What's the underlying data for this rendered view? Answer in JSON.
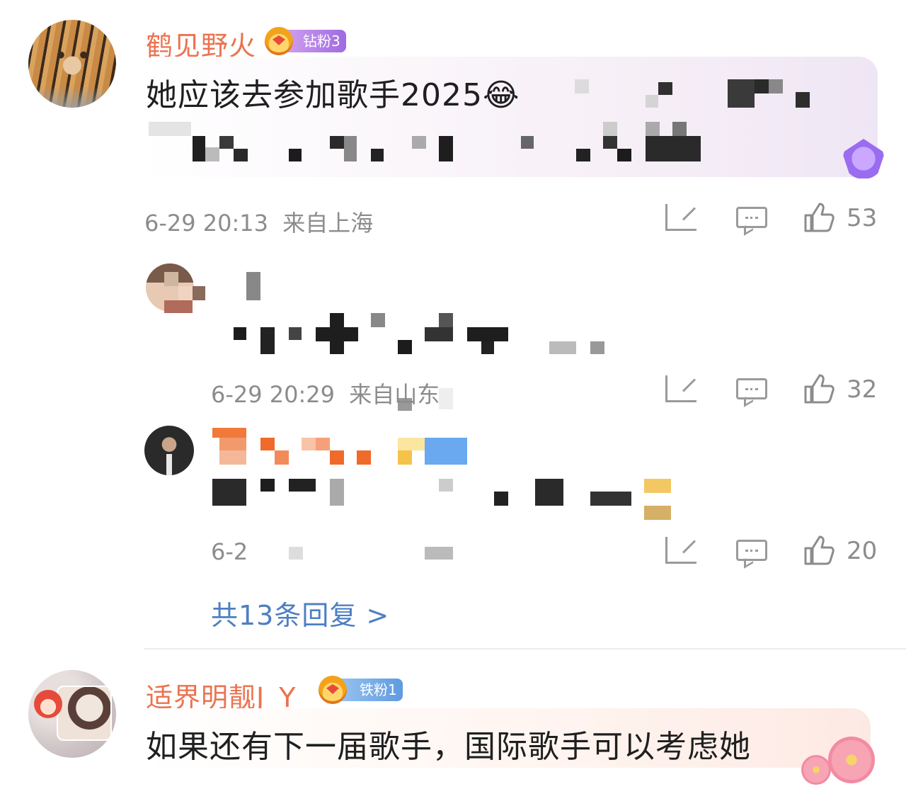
{
  "comments": [
    {
      "username": "鹤见野火",
      "badge": "钻粉3",
      "text_line1": "她应该去参加歌手2025😂",
      "time": "6-29 20:13",
      "location": "来自上海",
      "likes": "53",
      "replies": [
        {
          "time": "6-29 20:29",
          "location": "来自山东",
          "likes": "32"
        },
        {
          "time_partial": "6-2",
          "likes": "20"
        }
      ],
      "more_replies": "共13条回复 >"
    },
    {
      "username": "适界明靓J_Y",
      "badge": "铁粉1",
      "text_line1": "如果还有下一届歌手，国际歌手可以考虑她"
    }
  ],
  "colors": {
    "username": "#eb7350",
    "badge_diamond": "#b77ee8",
    "badge_iron": "#6fa8e8",
    "link": "#4d7fc1",
    "meta": "#8c8c8c"
  },
  "icons": [
    "share-icon",
    "comment-icon",
    "like-icon",
    "crown-badge-icon",
    "gem-icon",
    "flower-icon"
  ]
}
